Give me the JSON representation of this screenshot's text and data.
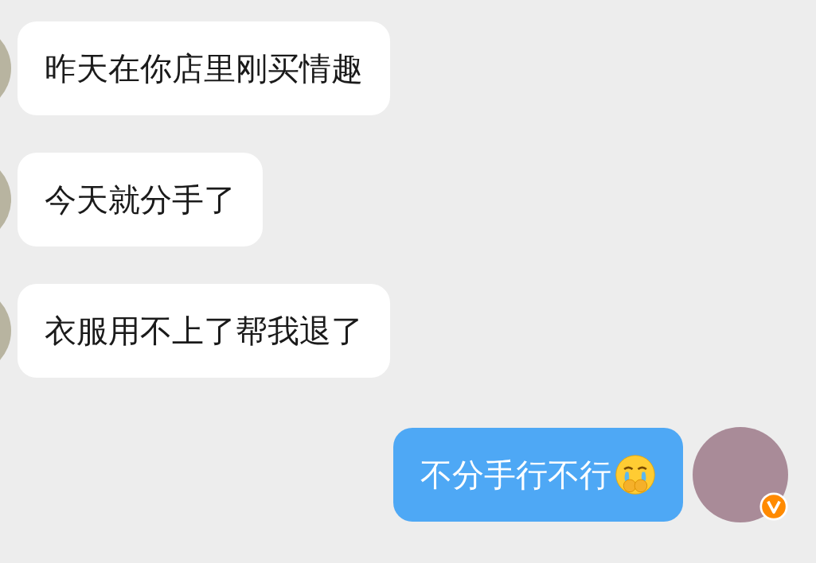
{
  "messages": [
    {
      "kind": "incoming",
      "text": "昨天在你店里刚买情趣"
    },
    {
      "kind": "incoming",
      "text": "今天就分手了"
    },
    {
      "kind": "incoming",
      "text": "衣服用不上了帮我退了"
    },
    {
      "kind": "outgoing",
      "text": "不分手行不行",
      "has_emoji": true,
      "verified": true
    }
  ]
}
